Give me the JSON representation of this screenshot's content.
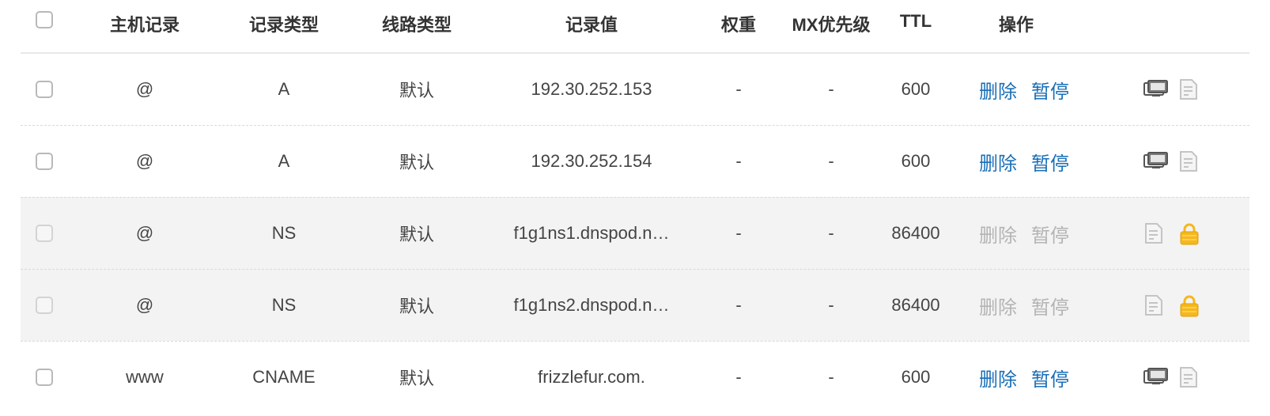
{
  "header": {
    "host": "主机记录",
    "type": "记录类型",
    "line": "线路类型",
    "value": "记录值",
    "weight": "权重",
    "mx": "MX优先级",
    "ttl": "TTL",
    "ops": "操作"
  },
  "rows": [
    {
      "host": "@",
      "type": "A",
      "line": "默认",
      "value": "192.30.252.153",
      "weight": "-",
      "mx": "-",
      "ttl": "600",
      "delete": "删除",
      "pause": "暂停",
      "disabled": false
    },
    {
      "host": "@",
      "type": "A",
      "line": "默认",
      "value": "192.30.252.154",
      "weight": "-",
      "mx": "-",
      "ttl": "600",
      "delete": "删除",
      "pause": "暂停",
      "disabled": false
    },
    {
      "host": "@",
      "type": "NS",
      "line": "默认",
      "value": "f1g1ns1.dnspod.n…",
      "weight": "-",
      "mx": "-",
      "ttl": "86400",
      "delete": "删除",
      "pause": "暂停",
      "disabled": true
    },
    {
      "host": "@",
      "type": "NS",
      "line": "默认",
      "value": "f1g1ns2.dnspod.n…",
      "weight": "-",
      "mx": "-",
      "ttl": "86400",
      "delete": "删除",
      "pause": "暂停",
      "disabled": true
    },
    {
      "host": "www",
      "type": "CNAME",
      "line": "默认",
      "value": "frizzlefur.com.",
      "weight": "-",
      "mx": "-",
      "ttl": "600",
      "delete": "删除",
      "pause": "暂停",
      "disabled": false
    }
  ],
  "icons": {
    "enabled": [
      "monitor-icon",
      "note-icon"
    ],
    "disabled": [
      "note-icon",
      "lock-icon"
    ]
  },
  "colors": {
    "link": "#1a6fb8",
    "muted": "#b4b4b4",
    "lock": "#f5b81c",
    "disabled_row_bg": "#f3f3f3"
  }
}
